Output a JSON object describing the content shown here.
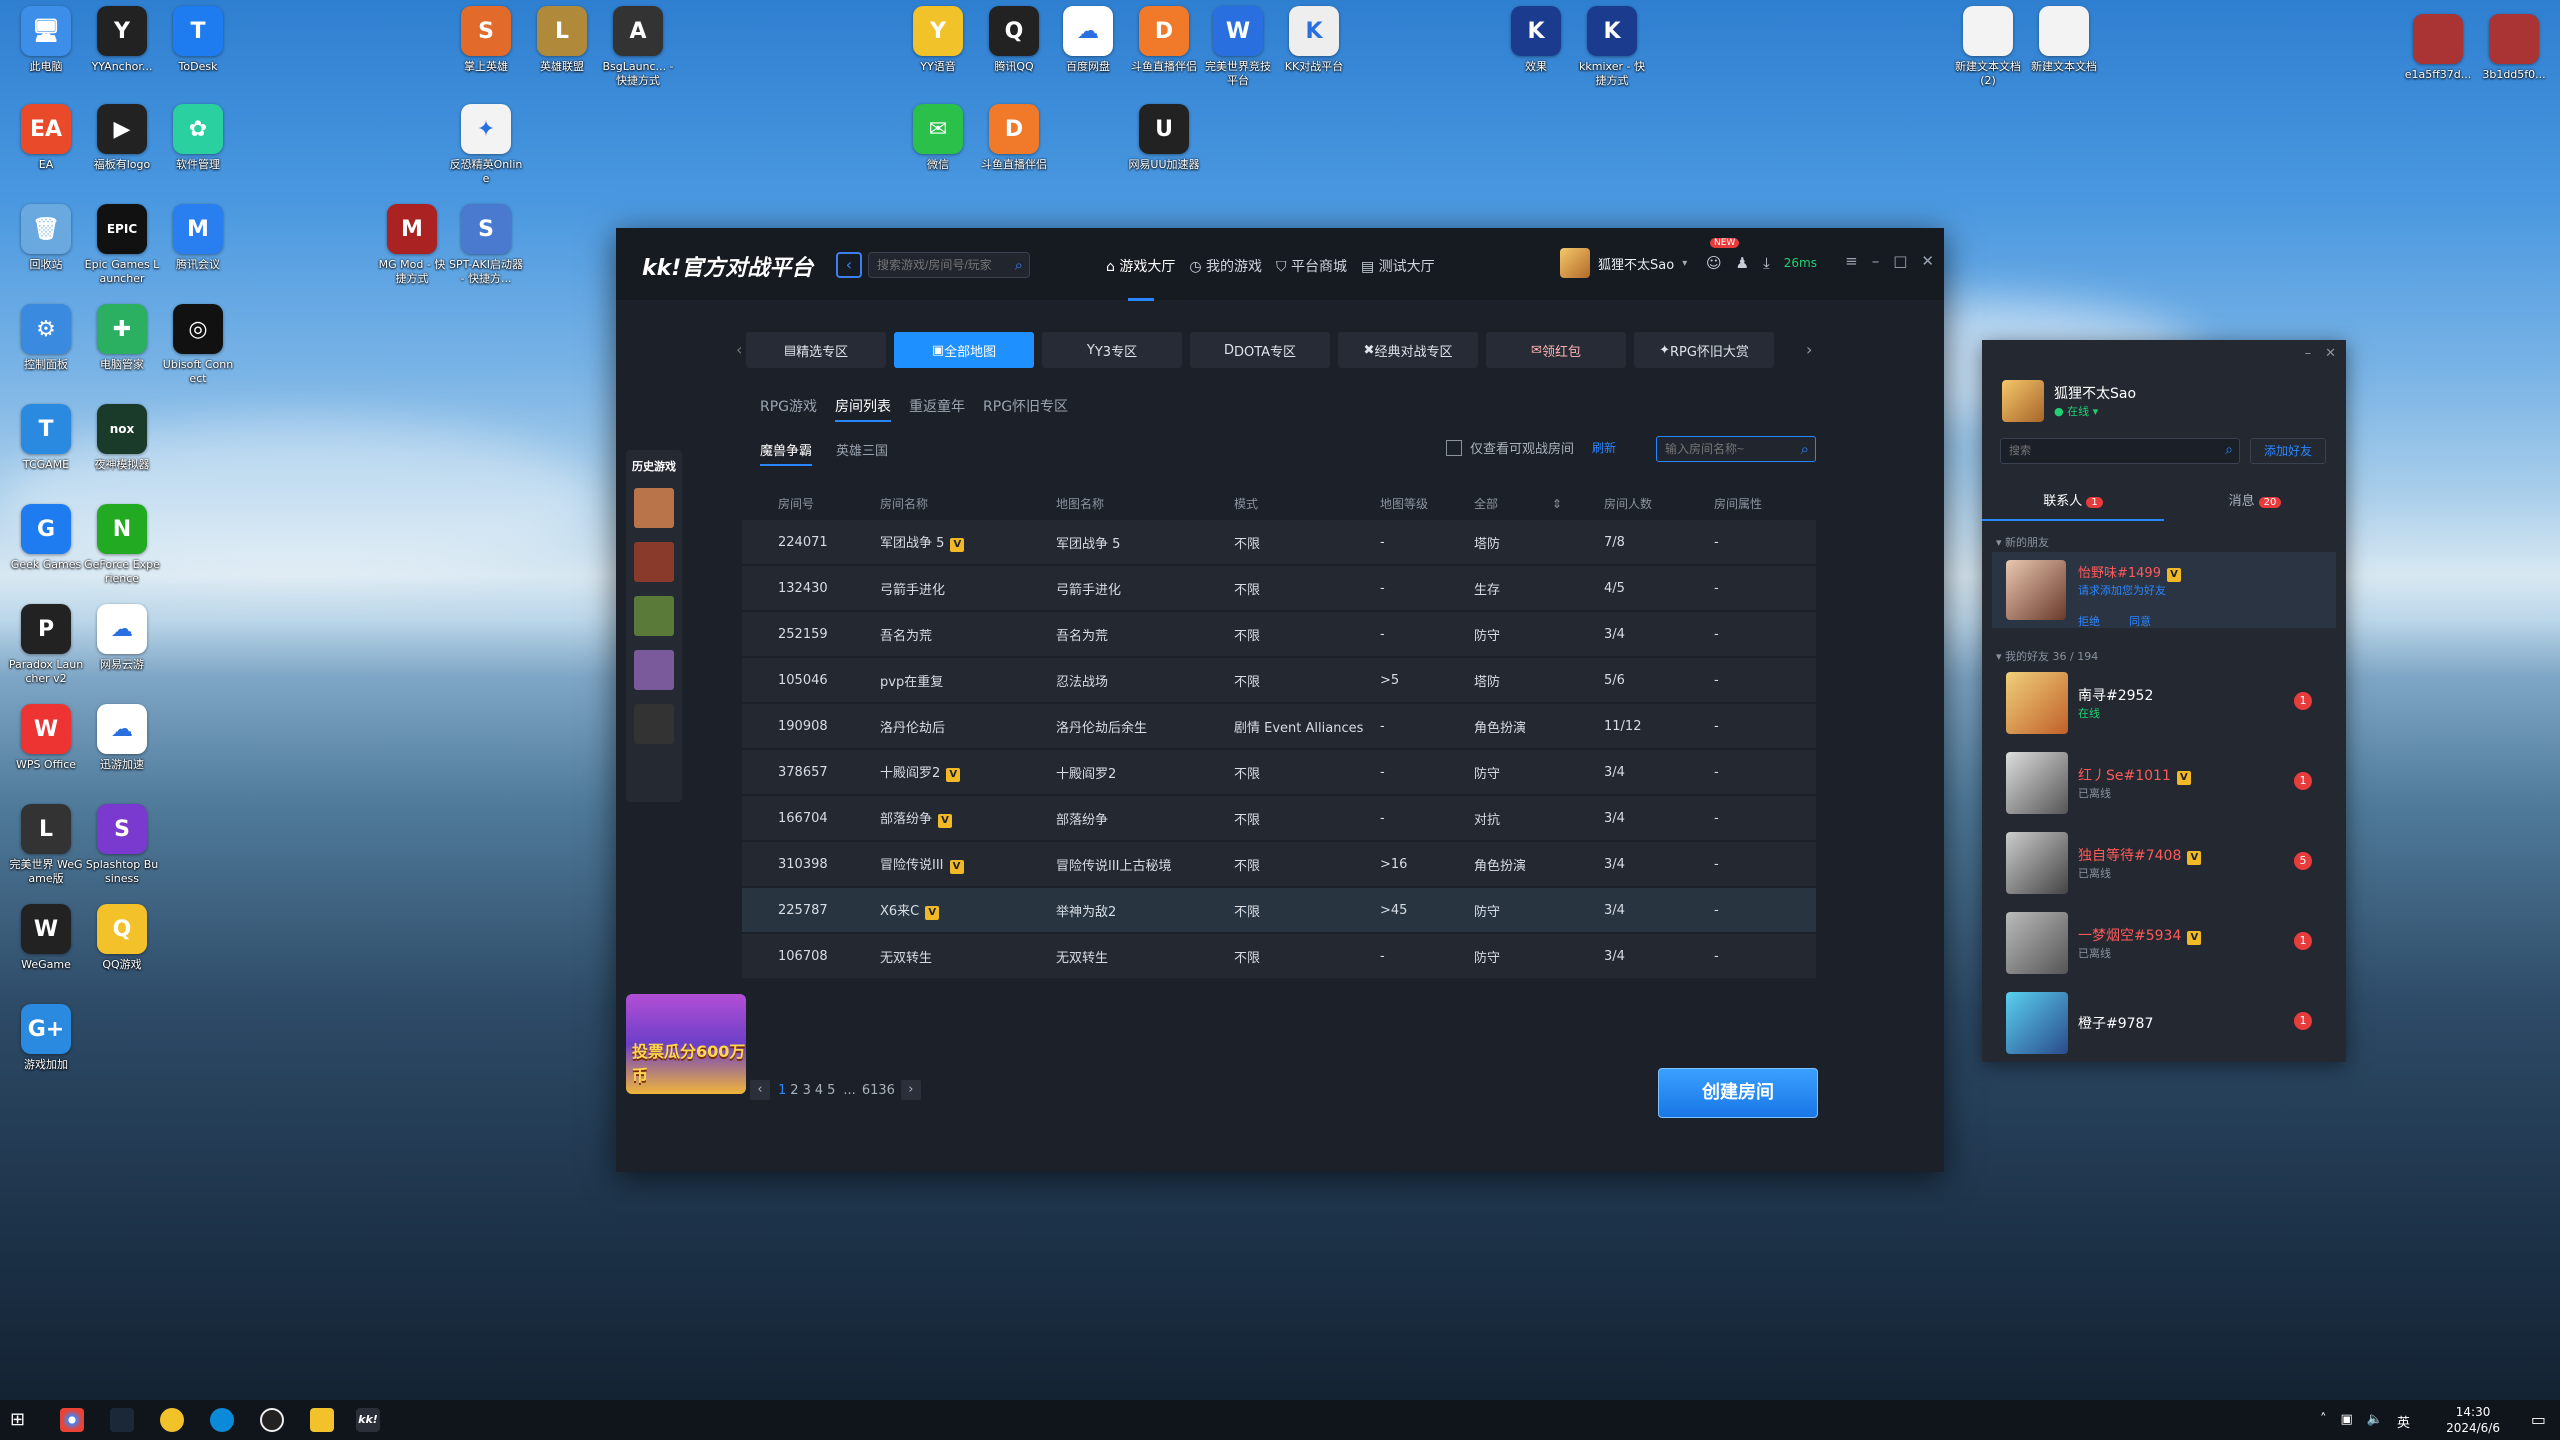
{
  "desktop": {
    "icons": [
      {
        "label": "此电脑",
        "color": "#3c8ee8",
        "glyph": "🖥"
      },
      {
        "label": "YYAnchor...",
        "color": "#222",
        "glyph": "Y"
      },
      {
        "label": "ToDesk",
        "color": "#1e7bf0",
        "glyph": "T"
      },
      {
        "label": "掌上英雄",
        "color": "#e26a2a",
        "glyph": "S"
      },
      {
        "label": "英雄联盟",
        "color": "#b08a3a",
        "glyph": "L"
      },
      {
        "label": "BsgLaunc... - 快捷方式",
        "color": "#333",
        "glyph": "A"
      },
      {
        "label": "YY语音",
        "color": "#f1c22a",
        "glyph": "Y"
      },
      {
        "label": "腾讯QQ",
        "color": "#222",
        "glyph": "Q"
      },
      {
        "label": "百度网盘",
        "color": "#ffffff",
        "glyph": "☁"
      },
      {
        "label": "斗鱼直播伴侣",
        "color": "#f07a2a",
        "glyph": "D"
      },
      {
        "label": "完美世界竞技平台",
        "color": "#2a6fe0",
        "glyph": "W"
      },
      {
        "label": "KK对战平台",
        "color": "#eee",
        "glyph": "K"
      },
      {
        "label": "效果",
        "color": "#1b3b8f",
        "glyph": "K"
      },
      {
        "label": "kkmixer - 快捷方式",
        "color": "#1b3b8f",
        "glyph": "K"
      },
      {
        "label": "新建文本文档 (2)",
        "color": "#f3f3f3",
        "glyph": ""
      },
      {
        "label": "新建文本文档",
        "color": "#f3f3f3",
        "glyph": ""
      },
      {
        "label": "e1a5ff37d...",
        "color": "#a33",
        "glyph": ""
      },
      {
        "label": "3b1dd5f0...",
        "color": "#a33",
        "glyph": ""
      },
      {
        "label": "EA",
        "color": "#e84a2a",
        "glyph": "EA"
      },
      {
        "label": "福板有logo",
        "color": "#222",
        "glyph": "▶"
      },
      {
        "label": "软件管理",
        "color": "#2ad0a0",
        "glyph": "✿"
      },
      {
        "label": "反恐精英Online",
        "color": "#f3f3f3",
        "glyph": "✦"
      },
      {
        "label": "微信",
        "color": "#2ac04a",
        "glyph": "✉"
      },
      {
        "label": "斗鱼直播伴侣",
        "color": "#f07a2a",
        "glyph": "D"
      },
      {
        "label": "网易UU加速器",
        "color": "#222",
        "glyph": "U"
      },
      {
        "label": "回收站",
        "color": "#6aa8e0",
        "glyph": "🗑"
      },
      {
        "label": "Epic Games Launcher",
        "color": "#111",
        "glyph": "EPIC"
      },
      {
        "label": "腾讯会议",
        "color": "#2a7ff0",
        "glyph": "M"
      },
      {
        "label": "MG Mod - 快捷方式",
        "color": "#a22",
        "glyph": "M"
      },
      {
        "label": "SPT-AKI启动器 - 快捷方...",
        "color": "#4a7ad0",
        "glyph": "S"
      },
      {
        "label": "控制面板",
        "color": "#3a8ae0",
        "glyph": "⚙"
      },
      {
        "label": "电脑管家",
        "color": "#2ab060",
        "glyph": "✚"
      },
      {
        "label": "Ubisoft Connect",
        "color": "#111",
        "glyph": "◎"
      },
      {
        "label": "TCGAME",
        "color": "#2a8ae0",
        "glyph": "T"
      },
      {
        "label": "夜神模拟器",
        "color": "#1a3a2a",
        "glyph": "nox"
      },
      {
        "label": "Geek Games",
        "color": "#1e7bf0",
        "glyph": "G"
      },
      {
        "label": "GeForce Experience",
        "color": "#2a2",
        "glyph": "N"
      },
      {
        "label": "Paradox Launcher v2",
        "color": "#222",
        "glyph": "P"
      },
      {
        "label": "网易云游",
        "color": "#fff",
        "glyph": "☁"
      },
      {
        "label": "WPS Office",
        "color": "#e33",
        "glyph": "W"
      },
      {
        "label": "迅游加速",
        "color": "#fff",
        "glyph": "☁"
      },
      {
        "label": "完美世界 WeGame版",
        "color": "#333",
        "glyph": "L"
      },
      {
        "label": "Splashtop Business",
        "color": "#7a3ad0",
        "glyph": "S"
      },
      {
        "label": "WeGame",
        "color": "#222",
        "glyph": "W"
      },
      {
        "label": "QQ游戏",
        "color": "#f3c22a",
        "glyph": "Q"
      },
      {
        "label": "游戏加加",
        "color": "#2a8ae0",
        "glyph": "G+"
      }
    ]
  },
  "app": {
    "logo": "kk!官方对战平台",
    "search_placeholder": "搜索游戏/房间号/玩家",
    "nav": [
      "游戏大厅",
      "我的游戏",
      "平台商城",
      "测试大厅"
    ],
    "user": "狐狸不太Sao",
    "new_badge": "NEW",
    "ping": "26ms"
  },
  "categories": [
    "精选专区",
    "全部地图",
    "Y3专区",
    "DOTA专区",
    "经典对战专区",
    "领红包",
    "RPG怀旧大赏"
  ],
  "subtabs": [
    "RPG游戏",
    "房间列表",
    "重返童年",
    "RPG怀旧专区"
  ],
  "gametabs": [
    "魔兽争霸",
    "英雄三国"
  ],
  "filter": {
    "label": "仅查看可观战房间",
    "refresh": "刷新",
    "room_placeholder": "输入房间名称~"
  },
  "history_title": "历史游戏",
  "history_colors": [
    "#b9744a",
    "#8a3a2a",
    "#5a7a3a",
    "#7a5a9a",
    "#333"
  ],
  "columns": [
    "房间号",
    "房间名称",
    "地图名称",
    "模式",
    "地图等级",
    "全部",
    "房间人数",
    "房间属性"
  ],
  "rooms": [
    {
      "id": "224071",
      "name": "军团战争 5",
      "vip": true,
      "map": "军团战争 5",
      "mode": "不限",
      "level": "-",
      "type": "塔防",
      "players": "7/8",
      "attr": "-"
    },
    {
      "id": "132430",
      "name": "弓箭手进化",
      "vip": false,
      "map": "弓箭手进化",
      "mode": "不限",
      "level": "-",
      "type": "生存",
      "players": "4/5",
      "attr": "-"
    },
    {
      "id": "252159",
      "name": "吾名为荒",
      "vip": false,
      "map": "吾名为荒",
      "mode": "不限",
      "level": "-",
      "type": "防守",
      "players": "3/4",
      "attr": "-"
    },
    {
      "id": "105046",
      "name": "pvp在重复",
      "vip": false,
      "map": "忍法战场",
      "mode": "不限",
      "level": ">5",
      "type": "塔防",
      "players": "5/6",
      "attr": "-"
    },
    {
      "id": "190908",
      "name": "洛丹伦劫后",
      "vip": false,
      "map": "洛丹伦劫后余生",
      "mode": "剧情 Event Alliances",
      "level": "-",
      "type": "角色扮演",
      "players": "11/12",
      "attr": "-"
    },
    {
      "id": "378657",
      "name": "十殿阎罗2",
      "vip": true,
      "map": "十殿阎罗2",
      "mode": "不限",
      "level": "-",
      "type": "防守",
      "players": "3/4",
      "attr": "-"
    },
    {
      "id": "166704",
      "name": "部落纷争",
      "vip": true,
      "map": "部落纷争",
      "mode": "不限",
      "level": "-",
      "type": "对抗",
      "players": "3/4",
      "attr": "-"
    },
    {
      "id": "310398",
      "name": "冒险传说III",
      "vip": true,
      "map": "冒险传说III上古秘境",
      "mode": "不限",
      "level": ">16",
      "type": "角色扮演",
      "players": "3/4",
      "attr": "-"
    },
    {
      "id": "225787",
      "name": "X6来C",
      "vip": true,
      "map": "举神为敌2",
      "mode": "不限",
      "level": ">45",
      "type": "防守",
      "players": "3/4",
      "attr": "-"
    },
    {
      "id": "106708",
      "name": "无双转生",
      "vip": false,
      "map": "无双转生",
      "mode": "不限",
      "level": "-",
      "type": "防守",
      "players": "3/4",
      "attr": "-"
    }
  ],
  "pager": {
    "pages": [
      "1",
      "2",
      "3",
      "4",
      "5"
    ],
    "ellipsis": "...",
    "last": "6136"
  },
  "create_button": "创建房间",
  "promo_text": "投票瓜分600万币",
  "chat": {
    "user": "狐狸不太Sao",
    "status": "在线",
    "search_placeholder": "搜索",
    "add_friend": "添加好友",
    "tab_contacts": "联系人",
    "contacts_badge": "1",
    "tab_messages": "消息",
    "messages_badge": "20",
    "new_friends": "新的朋友",
    "request": {
      "name": "怡野味#1499",
      "text": "请求添加您为好友",
      "reject": "拒绝",
      "accept": "同意"
    },
    "my_friends": "我的好友",
    "friends_count": "36 / 194",
    "friends": [
      {
        "name": "南寻#2952",
        "status": "在线",
        "online": true,
        "red": false,
        "badge": "1"
      },
      {
        "name": "红丿Se#1011",
        "status": "已离线",
        "online": false,
        "red": true,
        "badge": "1"
      },
      {
        "name": "独自等待#7408",
        "status": "已离线",
        "online": false,
        "red": true,
        "badge": "5"
      },
      {
        "name": "一梦烟空#5934",
        "status": "已离线",
        "online": false,
        "red": true,
        "badge": "1"
      },
      {
        "name": "橙子#9787",
        "status": "",
        "online": true,
        "red": false,
        "badge": "1"
      }
    ]
  },
  "taskbar": {
    "time": "14:30",
    "date": "2024/6/6",
    "ime": "英"
  }
}
